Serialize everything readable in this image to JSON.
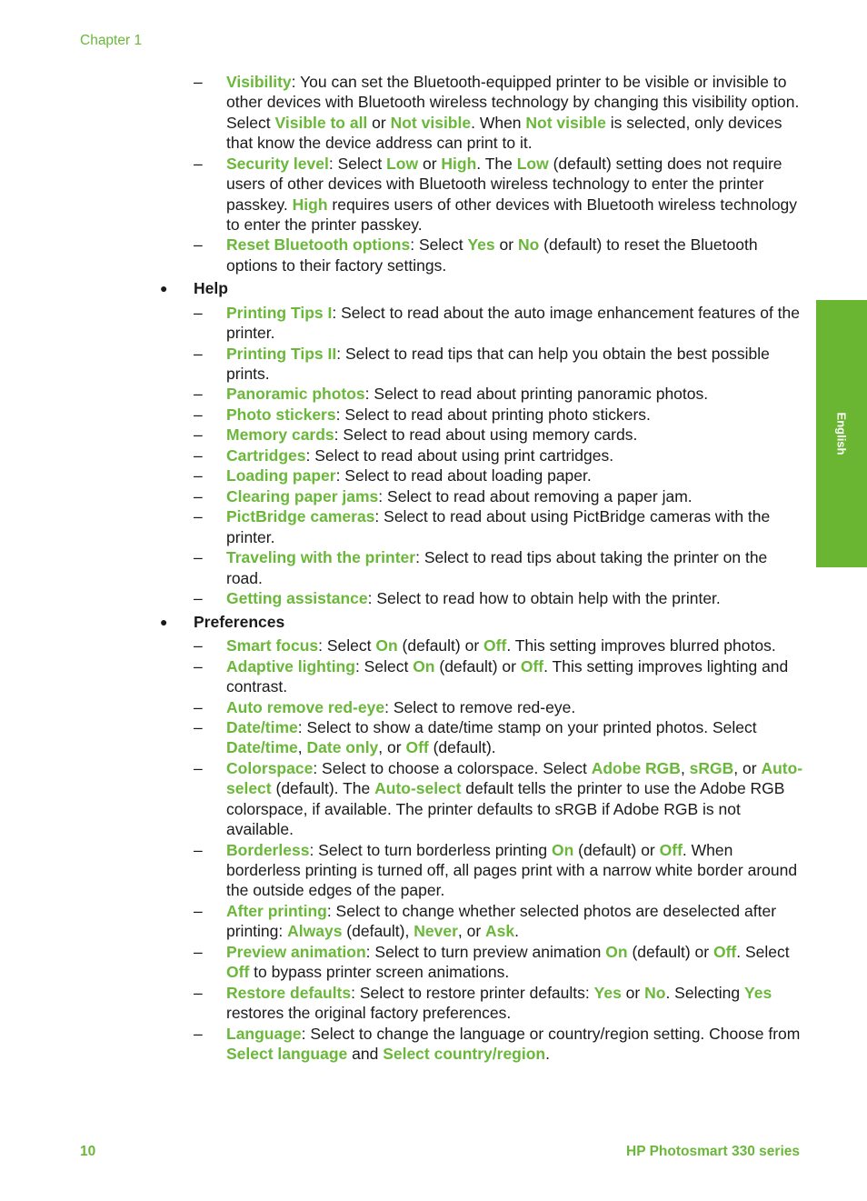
{
  "header": {
    "chapter": "Chapter 1"
  },
  "side_tab": {
    "label": "English"
  },
  "footer": {
    "page_number": "10",
    "product": "HP Photosmart 330 series"
  },
  "colors": {
    "accent": "#6ab73a",
    "tab": "#6ab633"
  },
  "content": [
    {
      "type": "sub",
      "segments": [
        {
          "t": "Visibility",
          "hl": true
        },
        {
          "t": ": You can set the Bluetooth-equipped printer to be visible or invisible to other devices with Bluetooth wireless technology by changing this visibility option. Select "
        },
        {
          "t": "Visible to all",
          "hl": true
        },
        {
          "t": " or "
        },
        {
          "t": "Not visible",
          "hl": true
        },
        {
          "t": ". When "
        },
        {
          "t": "Not visible",
          "hl": true
        },
        {
          "t": " is selected, only devices that know the device address can print to it."
        }
      ]
    },
    {
      "type": "sub",
      "segments": [
        {
          "t": "Security level",
          "hl": true
        },
        {
          "t": ": Select "
        },
        {
          "t": "Low",
          "hl": true
        },
        {
          "t": " or "
        },
        {
          "t": "High",
          "hl": true
        },
        {
          "t": ". The "
        },
        {
          "t": "Low",
          "hl": true
        },
        {
          "t": " (default) setting does not require users of other devices with Bluetooth wireless technology to enter the printer passkey. "
        },
        {
          "t": "High",
          "hl": true
        },
        {
          "t": " requires users of other devices with Bluetooth wireless technology to enter the printer passkey."
        }
      ]
    },
    {
      "type": "sub",
      "segments": [
        {
          "t": "Reset Bluetooth options",
          "hl": true
        },
        {
          "t": ": Select "
        },
        {
          "t": "Yes",
          "hl": true
        },
        {
          "t": " or "
        },
        {
          "t": "No",
          "hl": true
        },
        {
          "t": " (default) to reset the Bluetooth options to their factory settings."
        }
      ]
    },
    {
      "type": "bullet",
      "segments": [
        {
          "t": "Help"
        }
      ]
    },
    {
      "type": "sub",
      "segments": [
        {
          "t": "Printing Tips I",
          "hl": true
        },
        {
          "t": ": Select to read about the auto image enhancement features of the printer."
        }
      ]
    },
    {
      "type": "sub",
      "segments": [
        {
          "t": "Printing Tips II",
          "hl": true
        },
        {
          "t": ": Select to read tips that can help you obtain the best possible prints."
        }
      ]
    },
    {
      "type": "sub",
      "segments": [
        {
          "t": "Panoramic photos",
          "hl": true
        },
        {
          "t": ": Select to read about printing panoramic photos."
        }
      ]
    },
    {
      "type": "sub",
      "segments": [
        {
          "t": "Photo stickers",
          "hl": true
        },
        {
          "t": ": Select to read about printing photo stickers."
        }
      ]
    },
    {
      "type": "sub",
      "segments": [
        {
          "t": "Memory cards",
          "hl": true
        },
        {
          "t": ": Select to read about using memory cards."
        }
      ]
    },
    {
      "type": "sub",
      "segments": [
        {
          "t": "Cartridges",
          "hl": true
        },
        {
          "t": ": Select to read about using print cartridges."
        }
      ]
    },
    {
      "type": "sub",
      "segments": [
        {
          "t": "Loading paper",
          "hl": true
        },
        {
          "t": ": Select to read about loading paper."
        }
      ]
    },
    {
      "type": "sub",
      "segments": [
        {
          "t": "Clearing paper jams",
          "hl": true
        },
        {
          "t": ": Select to read about removing a paper jam."
        }
      ]
    },
    {
      "type": "sub",
      "segments": [
        {
          "t": "PictBridge cameras",
          "hl": true
        },
        {
          "t": ": Select to read about using PictBridge cameras with the printer."
        }
      ]
    },
    {
      "type": "sub",
      "segments": [
        {
          "t": "Traveling with the printer",
          "hl": true
        },
        {
          "t": ": Select to read tips about taking the printer on the road."
        }
      ]
    },
    {
      "type": "sub",
      "segments": [
        {
          "t": "Getting assistance",
          "hl": true
        },
        {
          "t": ": Select to read how to obtain help with the printer."
        }
      ]
    },
    {
      "type": "bullet",
      "segments": [
        {
          "t": "Preferences"
        }
      ]
    },
    {
      "type": "sub",
      "segments": [
        {
          "t": "Smart focus",
          "hl": true
        },
        {
          "t": ": Select "
        },
        {
          "t": "On",
          "hl": true
        },
        {
          "t": " (default) or "
        },
        {
          "t": "Off",
          "hl": true
        },
        {
          "t": ". This setting improves blurred photos."
        }
      ]
    },
    {
      "type": "sub",
      "segments": [
        {
          "t": "Adaptive lighting",
          "hl": true
        },
        {
          "t": ": Select "
        },
        {
          "t": "On",
          "hl": true
        },
        {
          "t": " (default) or "
        },
        {
          "t": "Off",
          "hl": true
        },
        {
          "t": ". This setting improves lighting and contrast."
        }
      ]
    },
    {
      "type": "sub",
      "segments": [
        {
          "t": "Auto remove red-eye",
          "hl": true
        },
        {
          "t": ": Select to remove red-eye."
        }
      ]
    },
    {
      "type": "sub",
      "segments": [
        {
          "t": "Date/time",
          "hl": true
        },
        {
          "t": ": Select to show a date/time stamp on your printed photos. Select "
        },
        {
          "t": "Date/time",
          "hl": true
        },
        {
          "t": ", "
        },
        {
          "t": "Date only",
          "hl": true
        },
        {
          "t": ", or "
        },
        {
          "t": "Off",
          "hl": true
        },
        {
          "t": " (default)."
        }
      ]
    },
    {
      "type": "sub",
      "segments": [
        {
          "t": "Colorspace",
          "hl": true
        },
        {
          "t": ": Select to choose a colorspace. Select "
        },
        {
          "t": "Adobe RGB",
          "hl": true
        },
        {
          "t": ", "
        },
        {
          "t": "sRGB",
          "hl": true
        },
        {
          "t": ", or "
        },
        {
          "t": "Auto-select",
          "hl": true
        },
        {
          "t": " (default). The "
        },
        {
          "t": "Auto-select",
          "hl": true
        },
        {
          "t": " default tells the printer to use the Adobe RGB colorspace, if available. The printer defaults to sRGB if Adobe RGB is not available."
        }
      ]
    },
    {
      "type": "sub",
      "segments": [
        {
          "t": "Borderless",
          "hl": true
        },
        {
          "t": ": Select to turn borderless printing "
        },
        {
          "t": "On",
          "hl": true
        },
        {
          "t": " (default) or "
        },
        {
          "t": "Off",
          "hl": true
        },
        {
          "t": ". When borderless printing is turned off, all pages print with a narrow white border around the outside edges of the paper."
        }
      ]
    },
    {
      "type": "sub",
      "segments": [
        {
          "t": "After printing",
          "hl": true
        },
        {
          "t": ": Select to change whether selected photos are deselected after printing: "
        },
        {
          "t": "Always",
          "hl": true
        },
        {
          "t": " (default), "
        },
        {
          "t": "Never",
          "hl": true
        },
        {
          "t": ", or "
        },
        {
          "t": "Ask",
          "hl": true
        },
        {
          "t": "."
        }
      ]
    },
    {
      "type": "sub",
      "segments": [
        {
          "t": "Preview animation",
          "hl": true
        },
        {
          "t": ": Select to turn preview animation "
        },
        {
          "t": "On",
          "hl": true
        },
        {
          "t": " (default) or "
        },
        {
          "t": "Off",
          "hl": true
        },
        {
          "t": ". Select "
        },
        {
          "t": "Off",
          "hl": true
        },
        {
          "t": " to bypass printer screen animations."
        }
      ]
    },
    {
      "type": "sub",
      "segments": [
        {
          "t": "Restore defaults",
          "hl": true
        },
        {
          "t": ": Select to restore printer defaults: "
        },
        {
          "t": "Yes",
          "hl": true
        },
        {
          "t": " or "
        },
        {
          "t": "No",
          "hl": true
        },
        {
          "t": ". Selecting "
        },
        {
          "t": "Yes",
          "hl": true
        },
        {
          "t": " restores the original factory preferences."
        }
      ]
    },
    {
      "type": "sub",
      "segments": [
        {
          "t": "Language",
          "hl": true
        },
        {
          "t": ": Select to change the language or country/region setting. Choose from "
        },
        {
          "t": "Select language",
          "hl": true
        },
        {
          "t": " and "
        },
        {
          "t": "Select country/region",
          "hl": true
        },
        {
          "t": "."
        }
      ]
    }
  ]
}
